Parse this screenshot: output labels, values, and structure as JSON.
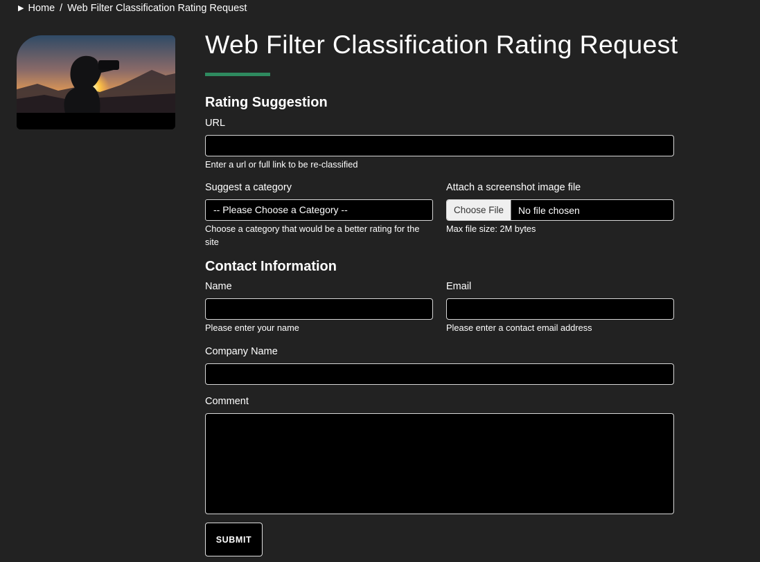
{
  "breadcrumb": {
    "home": "Home",
    "separator": "/",
    "current": "Web Filter Classification Rating Request"
  },
  "colors": {
    "background": "#222222",
    "accent": "#2e8a5f",
    "input_background": "#000000"
  },
  "page_title": "Web Filter Classification Rating Request",
  "rating_section": {
    "heading": "Rating Suggestion",
    "url_label": "URL",
    "url_value": "",
    "url_hint": "Enter a url or full link to be re-classified",
    "category_label": "Suggest a category",
    "category_selected": "-- Please Choose a Category --",
    "category_hint": "Choose a category that would be a better rating for the site",
    "screenshot_label": "Attach a screenshot image file",
    "choose_file_label": "Choose File",
    "file_status": "No file chosen",
    "file_hint": "Max file size: 2M bytes"
  },
  "contact_section": {
    "heading": "Contact Information",
    "name_label": "Name",
    "name_value": "",
    "name_hint": "Please enter your name",
    "email_label": "Email",
    "email_value": "",
    "email_hint": "Please enter a contact email address",
    "company_label": "Company Name",
    "company_value": "",
    "comment_label": "Comment",
    "comment_value": ""
  },
  "submit_label": "SUBMIT",
  "hero_image": {
    "icon": "binoculars-silhouette-sunset-image"
  }
}
